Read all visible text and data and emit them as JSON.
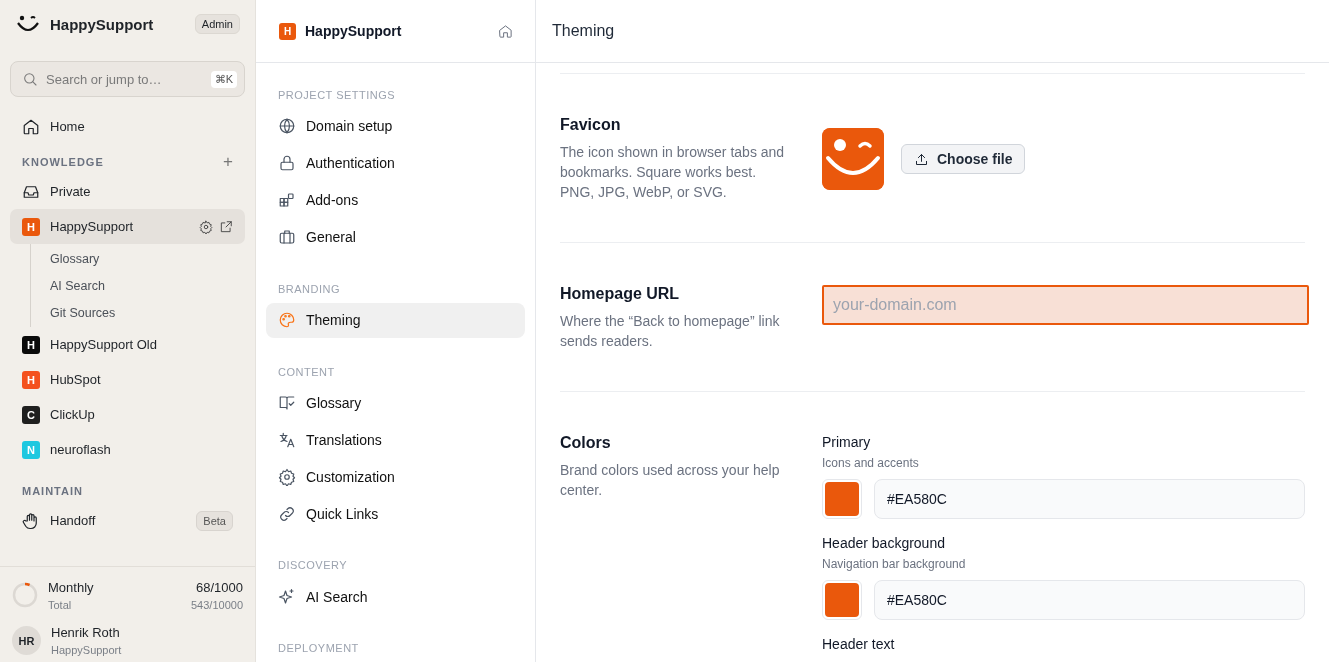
{
  "sidebar": {
    "brand": "HappySupport",
    "role": "Admin",
    "search": {
      "placeholder": "Search or jump to…",
      "shortcut": "⌘K"
    },
    "home": "Home",
    "knowledge": {
      "title": "KNOWLEDGE",
      "add": "+",
      "items": [
        {
          "kind": "inbox",
          "label": "Private",
          "selected": false
        },
        {
          "kind": "space",
          "letter": "H",
          "color": "#ea580c",
          "label": "HappySupport",
          "selected": true,
          "children": [
            {
              "label": "Glossary"
            },
            {
              "label": "AI Search"
            },
            {
              "label": "Git Sources"
            }
          ]
        },
        {
          "kind": "space",
          "letter": "H",
          "color": "#0a0a0a",
          "label": "HappySupport Old",
          "selected": false
        },
        {
          "kind": "space",
          "letter": "H",
          "color": "#f4511e",
          "label": "HubSpot",
          "selected": false
        },
        {
          "kind": "space",
          "letter": "C",
          "color": "#1f1f1f",
          "label": "ClickUp",
          "selected": false
        },
        {
          "kind": "space",
          "letter": "N",
          "color": "#1ec8e0",
          "label": "neuroflash",
          "selected": false
        }
      ]
    },
    "maintain": {
      "title": "MAINTAIN",
      "items": [
        {
          "label": "Handoff",
          "badge": "Beta"
        }
      ]
    },
    "usage": {
      "label": "Monthly",
      "value": "68/1000",
      "sub_label": "Total",
      "sub_value": "543/10000",
      "level": 0.068
    },
    "user": {
      "initials": "HR",
      "name": "Henrik Roth",
      "org": "HappySupport"
    }
  },
  "settings_nav": {
    "project": {
      "letter": "H",
      "name": "HappySupport"
    },
    "sections": [
      {
        "title": "PROJECT SETTINGS",
        "items": [
          {
            "label": "Domain setup",
            "selected": false
          },
          {
            "label": "Authentication",
            "selected": false
          },
          {
            "label": "Add-ons",
            "selected": false
          },
          {
            "label": "General",
            "selected": false
          }
        ]
      },
      {
        "title": "BRANDING",
        "items": [
          {
            "label": "Theming",
            "selected": true
          }
        ]
      },
      {
        "title": "CONTENT",
        "items": [
          {
            "label": "Glossary",
            "selected": false
          },
          {
            "label": "Translations",
            "selected": false
          },
          {
            "label": "Customization",
            "selected": false
          },
          {
            "label": "Quick Links",
            "selected": false
          }
        ]
      },
      {
        "title": "DISCOVERY",
        "items": [
          {
            "label": "AI Search",
            "selected": false
          }
        ]
      },
      {
        "title": "DEPLOYMENT"
      }
    ]
  },
  "main": {
    "title": "Theming",
    "favicon": {
      "title": "Favicon",
      "description": "The icon shown in browser tabs and bookmarks. Square works best. PNG, JPG, WebP, or SVG.",
      "button": "Choose file"
    },
    "homepage": {
      "title": "Homepage URL",
      "description": "Where the “Back to homepage” link sends readers.",
      "placeholder": "your-domain.com",
      "focused": true
    },
    "colors": {
      "title": "Colors",
      "description": "Brand colors used across your help center.",
      "fields": [
        {
          "label": "Primary",
          "hint": "Icons and accents",
          "value": "#EA580C",
          "color": "#ea580c"
        },
        {
          "label": "Header background",
          "hint": "Navigation bar background",
          "value": "#EA580C",
          "color": "#ea580c"
        },
        {
          "label": "Header text"
        }
      ]
    }
  }
}
